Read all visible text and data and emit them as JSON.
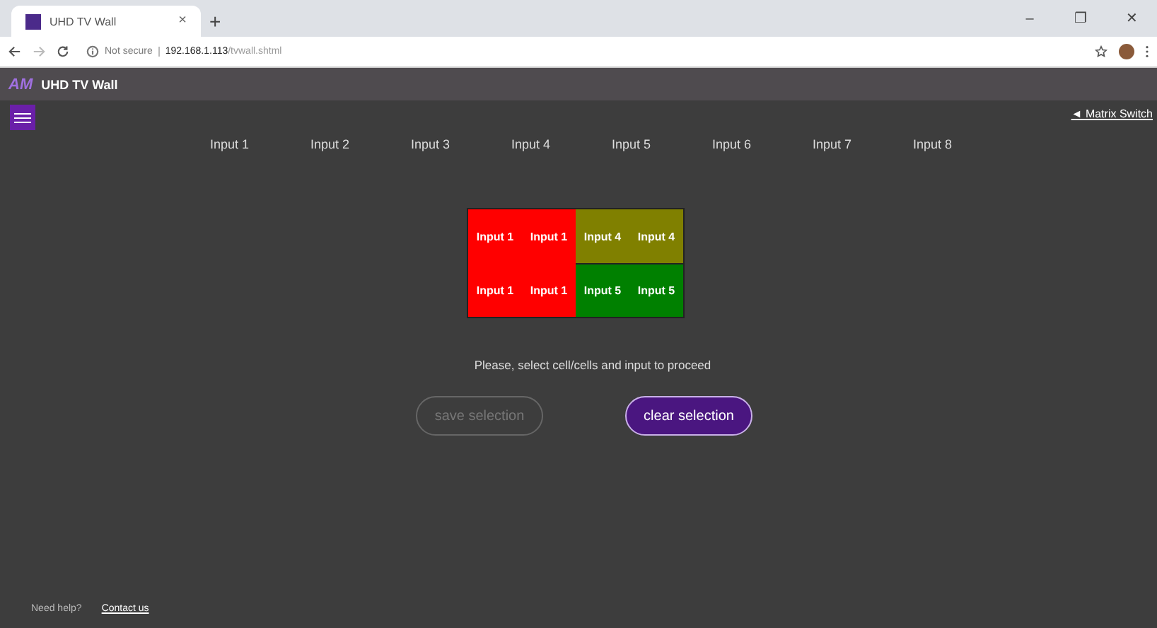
{
  "browser": {
    "tab_title": "UHD TV Wall",
    "tab_close": "×",
    "new_tab": "+",
    "security": "Not secure",
    "url_host": "192.168.1.113",
    "url_path": "/tvwall.shtml",
    "window_controls": [
      "–",
      "❐",
      "✕"
    ]
  },
  "app": {
    "logo": "AM",
    "title": "UHD TV Wall",
    "back_link": "◄ Matrix Switch"
  },
  "inputs": [
    {
      "label": "Input 1",
      "selected": false
    },
    {
      "label": "Input 2",
      "selected": false
    },
    {
      "label": "Input 3",
      "selected": false
    },
    {
      "label": "Input 4",
      "selected": false
    },
    {
      "label": "Input 5",
      "selected": false
    },
    {
      "label": "Input 6",
      "selected": false
    },
    {
      "label": "Input 7",
      "selected": false
    },
    {
      "label": "Input 8",
      "selected": false
    }
  ],
  "wall": [
    [
      {
        "label": "Input 1",
        "color": "#ff0000"
      },
      {
        "label": "Input 1",
        "color": "#ff0000"
      },
      {
        "label": "Input 4",
        "color": "#808000"
      },
      {
        "label": "Input 4",
        "color": "#808000"
      }
    ],
    [
      {
        "label": "Input 1",
        "color": "#ff0000"
      },
      {
        "label": "Input 1",
        "color": "#ff0000"
      },
      {
        "label": "Input 5",
        "color": "#008000"
      },
      {
        "label": "Input 5",
        "color": "#008000"
      }
    ]
  ],
  "message": "Please, select cell/cells and input to proceed",
  "buttons": [
    {
      "label": "save selection",
      "disabled": true
    },
    {
      "label": "clear selection",
      "disabled": false
    }
  ],
  "footer": {
    "help": "Need help?",
    "contact": "Contact us"
  }
}
